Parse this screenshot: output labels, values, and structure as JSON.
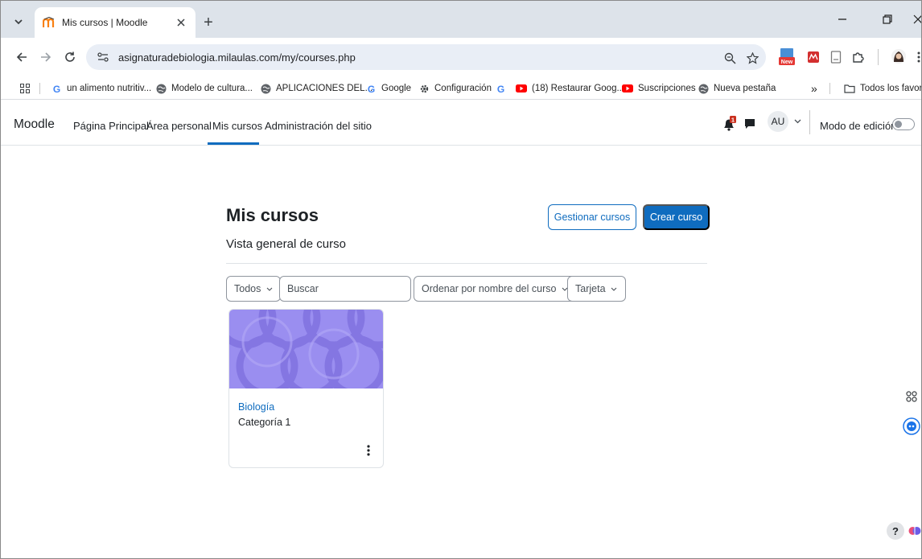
{
  "browser": {
    "tab": {
      "title": "Mis cursos | Moodle"
    },
    "new_tab_symbol": "+",
    "address_bar": {
      "url": "asignaturadebiologia.milaulas.com/my/courses.php"
    },
    "bookmarks": [
      {
        "label": "un alimento nutritiv...",
        "icon": "google-icon"
      },
      {
        "label": "Modelo de cultura...",
        "icon": "globe-icon"
      },
      {
        "label": "APLICACIONES DEL...",
        "icon": "globe-icon"
      },
      {
        "label": "Google",
        "icon": "google-icon"
      },
      {
        "label": "Configuración",
        "icon": "gear-icon"
      },
      {
        "label": "",
        "icon": "google-icon"
      },
      {
        "label": "(18) Restaurar Goog...",
        "icon": "youtube-icon"
      },
      {
        "label": "Suscripciones",
        "icon": "youtube-icon"
      },
      {
        "label": "Nueva pestaña",
        "icon": "globe-icon"
      }
    ],
    "bookmarks_overflow": "»",
    "all_bookmarks_label": "Todos los favoritos"
  },
  "moodle": {
    "brand": "Moodle",
    "nav": [
      {
        "label": "Página Principal",
        "active": false
      },
      {
        "label": "Área personal",
        "active": false
      },
      {
        "label": "Mis cursos",
        "active": true
      },
      {
        "label": "Administración del sitio",
        "active": false
      }
    ],
    "notification_count": "1",
    "avatar_initials": "AU",
    "edit_mode_label": "Modo de edición"
  },
  "page": {
    "title": "Mis cursos",
    "manage_button": "Gestionar cursos",
    "create_button": "Crear curso",
    "subtitle": "Vista general de curso",
    "filters": {
      "grouping": "Todos",
      "search_placeholder": "Buscar",
      "sort": "Ordenar por nombre del curso",
      "view": "Tarjeta"
    },
    "courses": [
      {
        "name": "Biología",
        "category": "Categoría 1"
      }
    ]
  },
  "colors": {
    "accent": "#0f6cbf",
    "course_banner": "#9a8ef0"
  }
}
